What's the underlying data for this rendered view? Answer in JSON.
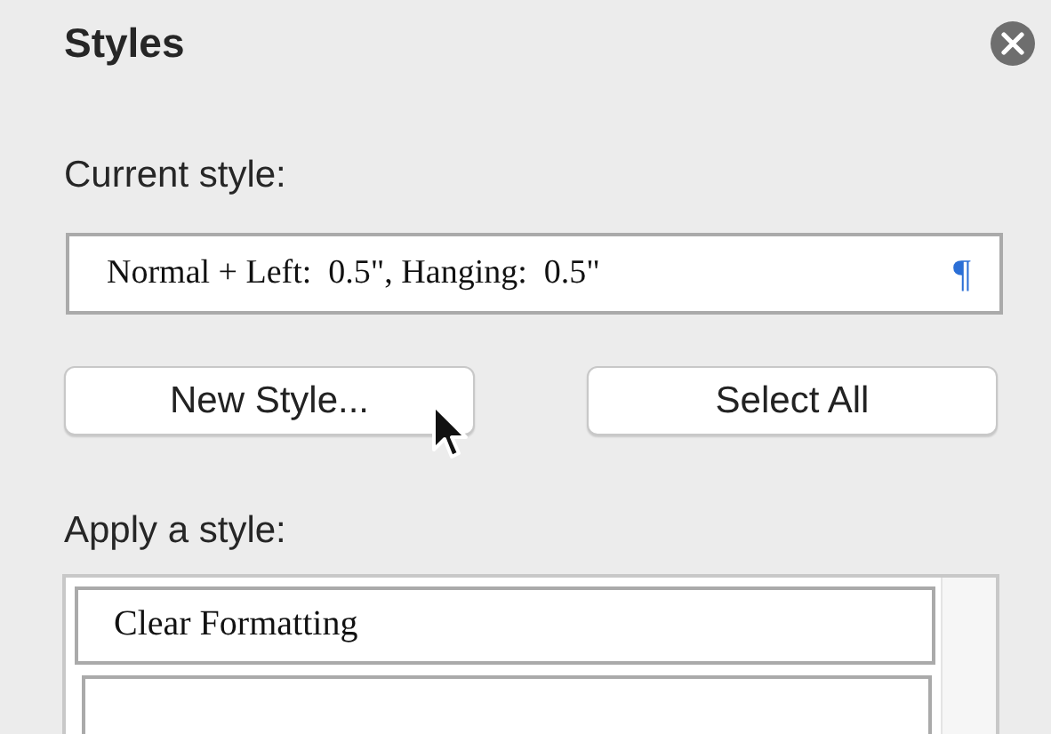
{
  "panel": {
    "title": "Styles"
  },
  "current_style": {
    "label": "Current style:",
    "value": "Normal + Left:  0.5\", Hanging:  0.5\"",
    "mark": "¶"
  },
  "buttons": [
    "New Style...",
    "Select All"
  ],
  "apply_style": {
    "label": "Apply a style:",
    "items": [
      {
        "label": "Clear Formatting"
      }
    ]
  }
}
